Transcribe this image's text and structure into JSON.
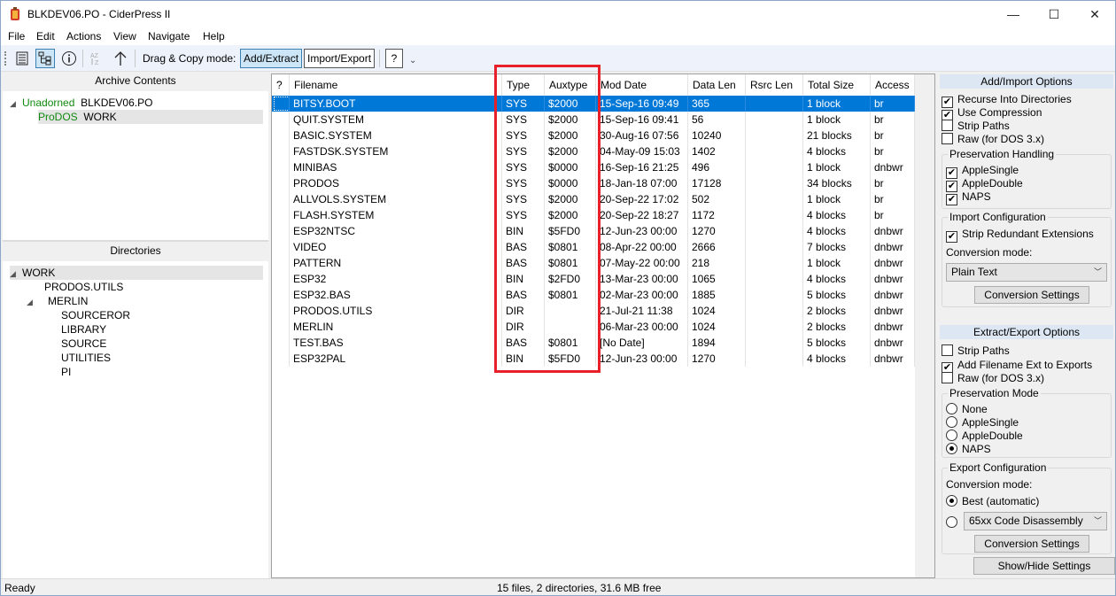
{
  "window": {
    "title": "BLKDEV06.PO - CiderPress II",
    "minimize_glyph": "—",
    "maximize_glyph": "☐",
    "close_glyph": "✕"
  },
  "menu": [
    "File",
    "Edit",
    "Actions",
    "View",
    "Navigate",
    "Help"
  ],
  "toolbar": {
    "drag_copy_label": "Drag & Copy mode:",
    "add_extract": "Add/Extract",
    "import_export": "Import/Export",
    "help_glyph": "?",
    "overflow_glyph": "⌄"
  },
  "archive_pane": {
    "title": "Archive Contents",
    "nodes": [
      {
        "kind": "Unadorned",
        "name": "BLKDEV06.PO"
      },
      {
        "kind": "ProDOS",
        "name": "WORK"
      }
    ]
  },
  "dir_pane": {
    "title": "Directories",
    "root": "WORK",
    "children": [
      "PRODOS.UTILS",
      "MERLIN"
    ],
    "merlin_children": [
      "SOURCEROR",
      "LIBRARY",
      "SOURCE",
      "UTILITIES",
      "PI"
    ]
  },
  "file_list": {
    "columns": [
      "?",
      "Filename",
      "Type",
      "Auxtype",
      "Mod Date",
      "Data Len",
      "Rsrc Len",
      "Total Size",
      "Access"
    ],
    "rows": [
      {
        "name": "BITSY.BOOT",
        "type": "SYS",
        "aux": "$2000",
        "date": "15-Sep-16 09:49",
        "dlen": "365",
        "rlen": "",
        "size": "1 block",
        "access": "br"
      },
      {
        "name": "QUIT.SYSTEM",
        "type": "SYS",
        "aux": "$2000",
        "date": "15-Sep-16 09:41",
        "dlen": "56",
        "rlen": "",
        "size": "1 block",
        "access": "br"
      },
      {
        "name": "BASIC.SYSTEM",
        "type": "SYS",
        "aux": "$2000",
        "date": "30-Aug-16 07:56",
        "dlen": "10240",
        "rlen": "",
        "size": "21 blocks",
        "access": "br"
      },
      {
        "name": "FASTDSK.SYSTEM",
        "type": "SYS",
        "aux": "$2000",
        "date": "04-May-09 15:03",
        "dlen": "1402",
        "rlen": "",
        "size": "4 blocks",
        "access": "br"
      },
      {
        "name": "MINIBAS",
        "type": "SYS",
        "aux": "$0000",
        "date": "16-Sep-16 21:25",
        "dlen": "496",
        "rlen": "",
        "size": "1 block",
        "access": "dnbwr"
      },
      {
        "name": "PRODOS",
        "type": "SYS",
        "aux": "$0000",
        "date": "18-Jan-18 07:00",
        "dlen": "17128",
        "rlen": "",
        "size": "34 blocks",
        "access": "br"
      },
      {
        "name": "ALLVOLS.SYSTEM",
        "type": "SYS",
        "aux": "$2000",
        "date": "20-Sep-22 17:02",
        "dlen": "502",
        "rlen": "",
        "size": "1 block",
        "access": "br"
      },
      {
        "name": "FLASH.SYSTEM",
        "type": "SYS",
        "aux": "$2000",
        "date": "20-Sep-22 18:27",
        "dlen": "1172",
        "rlen": "",
        "size": "4 blocks",
        "access": "br"
      },
      {
        "name": "ESP32NTSC",
        "type": "BIN",
        "aux": "$5FD0",
        "date": "12-Jun-23 00:00",
        "dlen": "1270",
        "rlen": "",
        "size": "4 blocks",
        "access": "dnbwr"
      },
      {
        "name": "VIDEO",
        "type": "BAS",
        "aux": "$0801",
        "date": "08-Apr-22 00:00",
        "dlen": "2666",
        "rlen": "",
        "size": "7 blocks",
        "access": "dnbwr"
      },
      {
        "name": "PATTERN",
        "type": "BAS",
        "aux": "$0801",
        "date": "07-May-22 00:00",
        "dlen": "218",
        "rlen": "",
        "size": "1 block",
        "access": "dnbwr"
      },
      {
        "name": "ESP32",
        "type": "BIN",
        "aux": "$2FD0",
        "date": "13-Mar-23 00:00",
        "dlen": "1065",
        "rlen": "",
        "size": "4 blocks",
        "access": "dnbwr"
      },
      {
        "name": "ESP32.BAS",
        "type": "BAS",
        "aux": "$0801",
        "date": "02-Mar-23 00:00",
        "dlen": "1885",
        "rlen": "",
        "size": "5 blocks",
        "access": "dnbwr"
      },
      {
        "name": "PRODOS.UTILS",
        "type": "DIR",
        "aux": "",
        "date": "21-Jul-21 11:38",
        "dlen": "1024",
        "rlen": "",
        "size": "2 blocks",
        "access": "dnbwr"
      },
      {
        "name": "MERLIN",
        "type": "DIR",
        "aux": "",
        "date": "06-Mar-23 00:00",
        "dlen": "1024",
        "rlen": "",
        "size": "2 blocks",
        "access": "dnbwr"
      },
      {
        "name": "TEST.BAS",
        "type": "BAS",
        "aux": "$0801",
        "date": "[No Date]",
        "dlen": "1894",
        "rlen": "",
        "size": "5 blocks",
        "access": "dnbwr"
      },
      {
        "name": "ESP32PAL",
        "type": "BIN",
        "aux": "$5FD0",
        "date": "12-Jun-23 00:00",
        "dlen": "1270",
        "rlen": "",
        "size": "4 blocks",
        "access": "dnbwr"
      }
    ]
  },
  "add_import": {
    "header": "Add/Import Options",
    "recurse": "Recurse Into Directories",
    "compression": "Use Compression",
    "strip_paths": "Strip Paths",
    "raw": "Raw (for DOS 3.x)",
    "preservation_title": "Preservation Handling",
    "apple_single": "AppleSingle",
    "apple_double": "AppleDouble",
    "naps": "NAPS",
    "import_config_title": "Import Configuration",
    "strip_ext": "Strip Redundant Extensions",
    "conv_mode_label": "Conversion mode:",
    "conv_mode_value": "Plain Text",
    "conv_settings": "Conversion Settings"
  },
  "extract_export": {
    "header": "Extract/Export Options",
    "strip_paths": "Strip Paths",
    "add_ext": "Add Filename Ext to Exports",
    "raw": "Raw (for DOS 3.x)",
    "preservation_title": "Preservation Mode",
    "none": "None",
    "apple_single": "AppleSingle",
    "apple_double": "AppleDouble",
    "naps": "NAPS",
    "export_config_title": "Export Configuration",
    "conv_mode_label": "Conversion mode:",
    "best": "Best (automatic)",
    "disasm": "65xx Code Disassembly",
    "conv_settings": "Conversion Settings",
    "show_hide": "Show/Hide Settings"
  },
  "status": {
    "left": "Ready",
    "center": "15 files, 2 directories, 31.6 MB free"
  },
  "colors": {
    "selection": "#0078d7",
    "annotation_box": "#e8202a",
    "archive_kind_green": "#118a11"
  }
}
